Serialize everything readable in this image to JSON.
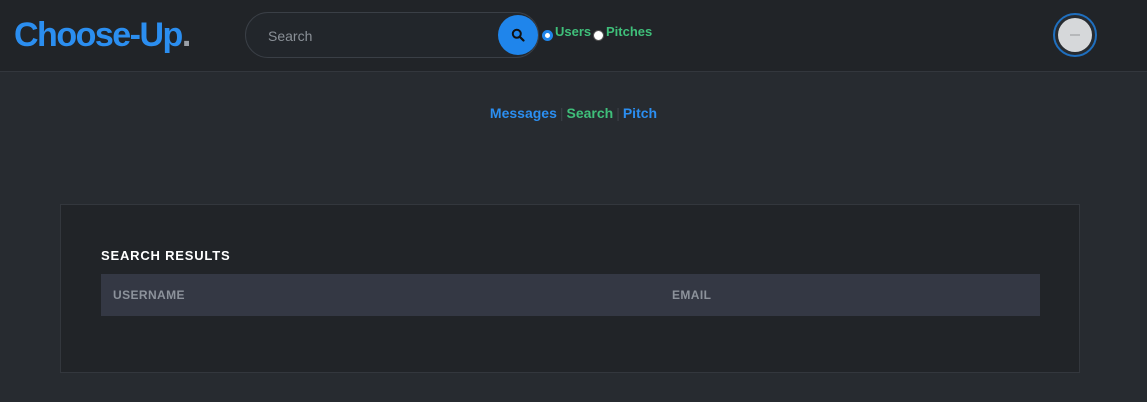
{
  "header": {
    "logo_text": "Choose-Up",
    "logo_dot": ".",
    "search_placeholder": "Search",
    "search_icon": "magnifier-icon",
    "radio_users_label": "Users",
    "radio_pitches_label": "Pitches",
    "selected_filter": "Users"
  },
  "subnav": {
    "messages": "Messages",
    "search": "Search",
    "pitch": "Pitch",
    "separator": "|"
  },
  "results": {
    "title": "SEARCH RESULTS",
    "columns": [
      "USERNAME",
      "EMAIL"
    ]
  },
  "colors": {
    "accent": "#2b8ef0",
    "green": "#3fbf7a",
    "background": "#272b30",
    "panel": "#212428"
  }
}
